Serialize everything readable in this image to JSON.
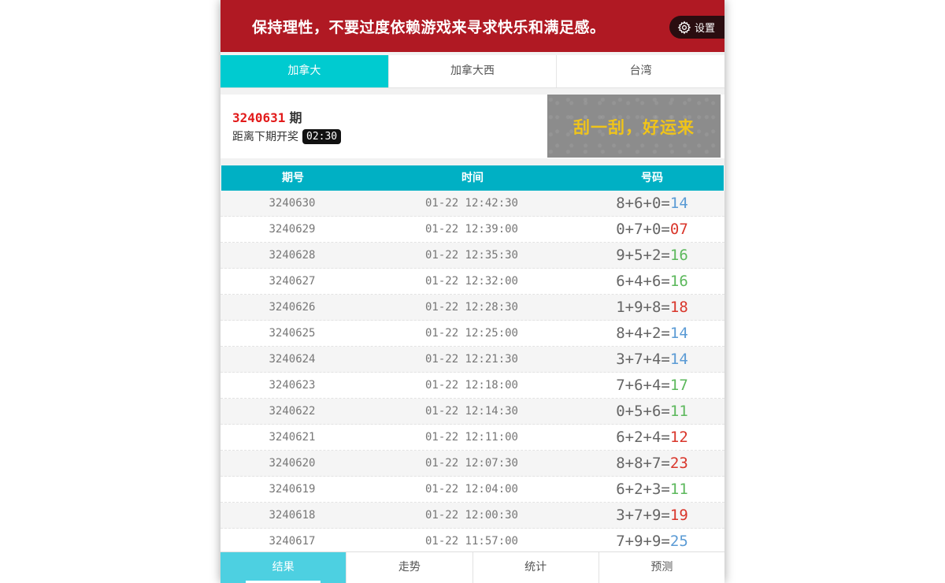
{
  "banner": {
    "message": "保持理性，不要过度依赖游戏来寻求快乐和满足感。",
    "settings_label": "设置",
    "color": "#b01923"
  },
  "region_tabs": [
    {
      "label": "加拿大",
      "active": true
    },
    {
      "label": "加拿大西",
      "active": false
    },
    {
      "label": "台湾",
      "active": false
    }
  ],
  "current": {
    "issue": "3240631",
    "issue_suffix": "期",
    "next_draw_label": "距离下期开奖",
    "countdown": "02:30"
  },
  "scratch_card": {
    "label": "刮一刮，好运来"
  },
  "table": {
    "headers": [
      "期号",
      "时间",
      "号码"
    ],
    "rows": [
      {
        "issue": "3240630",
        "time": "01-22 12:42:30",
        "expr": "8+6+0=",
        "sum": "14",
        "color": "blue"
      },
      {
        "issue": "3240629",
        "time": "01-22 12:39:00",
        "expr": "0+7+0=",
        "sum": "07",
        "color": "red"
      },
      {
        "issue": "3240628",
        "time": "01-22 12:35:30",
        "expr": "9+5+2=",
        "sum": "16",
        "color": "green"
      },
      {
        "issue": "3240627",
        "time": "01-22 12:32:00",
        "expr": "6+4+6=",
        "sum": "16",
        "color": "green"
      },
      {
        "issue": "3240626",
        "time": "01-22 12:28:30",
        "expr": "1+9+8=",
        "sum": "18",
        "color": "red"
      },
      {
        "issue": "3240625",
        "time": "01-22 12:25:00",
        "expr": "8+4+2=",
        "sum": "14",
        "color": "blue"
      },
      {
        "issue": "3240624",
        "time": "01-22 12:21:30",
        "expr": "3+7+4=",
        "sum": "14",
        "color": "blue"
      },
      {
        "issue": "3240623",
        "time": "01-22 12:18:00",
        "expr": "7+6+4=",
        "sum": "17",
        "color": "green"
      },
      {
        "issue": "3240622",
        "time": "01-22 12:14:30",
        "expr": "0+5+6=",
        "sum": "11",
        "color": "green"
      },
      {
        "issue": "3240621",
        "time": "01-22 12:11:00",
        "expr": "6+2+4=",
        "sum": "12",
        "color": "red"
      },
      {
        "issue": "3240620",
        "time": "01-22 12:07:30",
        "expr": "8+8+7=",
        "sum": "23",
        "color": "red"
      },
      {
        "issue": "3240619",
        "time": "01-22 12:04:00",
        "expr": "6+2+3=",
        "sum": "11",
        "color": "green"
      },
      {
        "issue": "3240618",
        "time": "01-22 12:00:30",
        "expr": "3+7+9=",
        "sum": "19",
        "color": "red"
      },
      {
        "issue": "3240617",
        "time": "01-22 11:57:00",
        "expr": "7+9+9=",
        "sum": "25",
        "color": "blue"
      }
    ]
  },
  "bottom_nav": [
    {
      "label": "结果",
      "active": true
    },
    {
      "label": "走势",
      "active": false
    },
    {
      "label": "统计",
      "active": false
    },
    {
      "label": "预测",
      "active": false
    }
  ],
  "colors": {
    "accent": "#00cbd0",
    "table_header": "#00b0c4",
    "blue": "#5b9bd5",
    "red": "#d9362b",
    "green": "#5cb85c"
  }
}
